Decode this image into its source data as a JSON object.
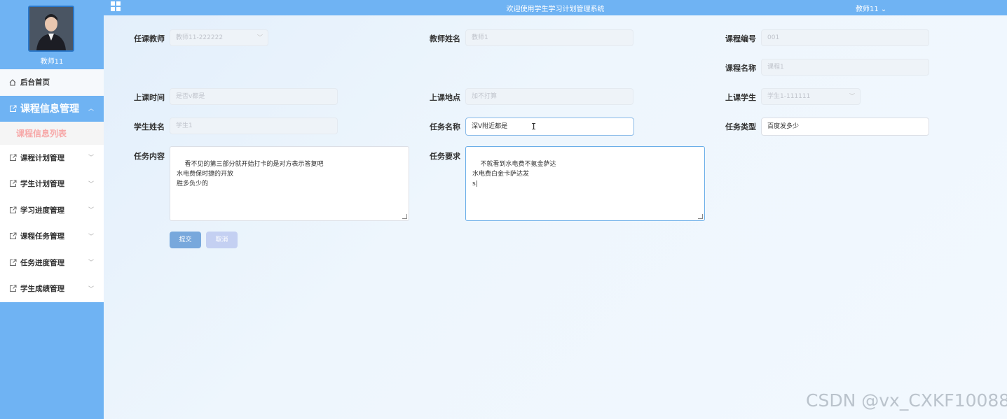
{
  "header": {
    "title": "欢迎使用学生学习计划管理系统",
    "user": "教师11 ⌄"
  },
  "sidebar": {
    "profile_name": "教师11",
    "home": "后台首页",
    "active_group": "课程信息管理",
    "active_sub": "课程信息列表",
    "items": [
      {
        "label": "课程计划管理"
      },
      {
        "label": "学生计划管理"
      },
      {
        "label": "学习进度管理"
      },
      {
        "label": "课程任务管理"
      },
      {
        "label": "任务进度管理"
      },
      {
        "label": "学生成绩管理"
      }
    ]
  },
  "form": {
    "teacher": {
      "label": "任课教师",
      "value": "教师11-222222"
    },
    "teacher_name": {
      "label": "教师姓名",
      "value": "教师1"
    },
    "course_no": {
      "label": "课程编号",
      "value": "001"
    },
    "course_name": {
      "label": "课程名称",
      "value": "课程1"
    },
    "class_time": {
      "label": "上课时间",
      "value": "是否v都是"
    },
    "class_place": {
      "label": "上课地点",
      "value": "加不打算"
    },
    "class_student": {
      "label": "上课学生",
      "value": "学生1-111111"
    },
    "student_name": {
      "label": "学生姓名",
      "value": "学生1"
    },
    "task_name": {
      "label": "任务名称",
      "value": "深V附近都是"
    },
    "task_type": {
      "label": "任务类型",
      "value": "百度发多少"
    },
    "task_content": {
      "label": "任务内容",
      "value": "看不见的第三部分就开始打卡的是对方表示答复吧\n水电费保时捷的开放\n胜多负少的"
    },
    "task_require": {
      "label": "任务要求",
      "value": "不就看到水电费不氪金萨达\n水电费白金卡萨达发\ns|"
    },
    "submit": "提交",
    "cancel": "取消"
  },
  "watermark": "CSDN @vx_CXKF10088"
}
